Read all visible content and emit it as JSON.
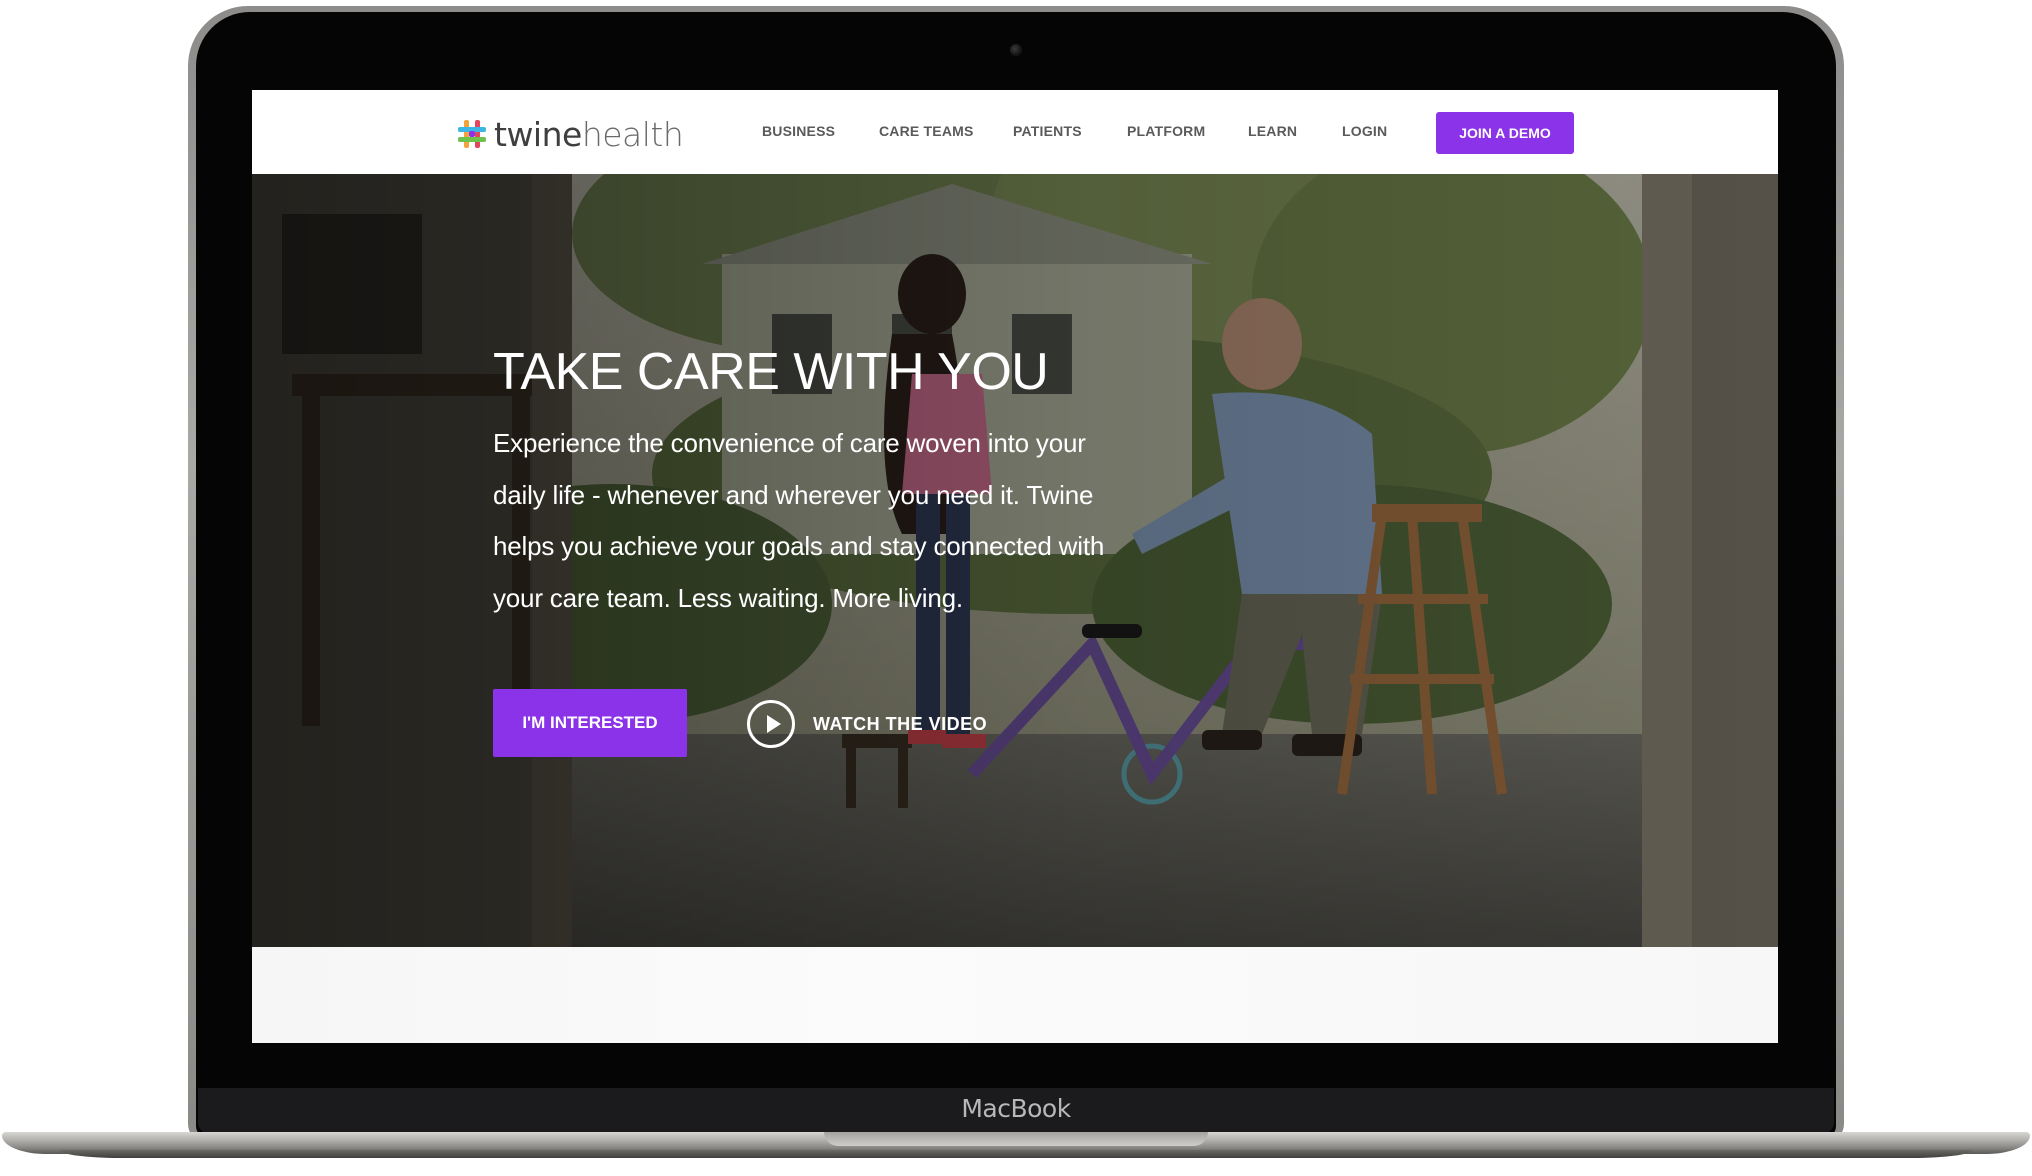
{
  "device": {
    "brand_label": "MacBook"
  },
  "site": {
    "logo": {
      "word_bold": "twine",
      "word_light": "health",
      "icon": "twine-knot-icon",
      "colors": [
        "#f2a33a",
        "#e2475d",
        "#3cb7e3",
        "#8a33e8",
        "#6cc24a"
      ]
    },
    "nav": {
      "items": [
        {
          "label": "BUSINESS"
        },
        {
          "label": "CARE TEAMS"
        },
        {
          "label": "PATIENTS"
        },
        {
          "label": "PLATFORM"
        },
        {
          "label": "LEARN"
        },
        {
          "label": "LOGIN"
        }
      ],
      "cta_label": "JOIN A DEMO"
    },
    "hero": {
      "title": "TAKE CARE WITH YOU",
      "body": "Experience the convenience of care woven into your daily life - whenever and wherever you need it. Twine helps you achieve your goals and stay connected with your care team. Less waiting. More living.",
      "primary_button": "I'M INTERESTED",
      "video_link": "WATCH THE VIDEO",
      "video_icon": "play-circle-icon"
    }
  },
  "colors": {
    "accent": "#8a33e8",
    "nav_text": "#5a5a5a",
    "hero_text": "#ffffff"
  }
}
